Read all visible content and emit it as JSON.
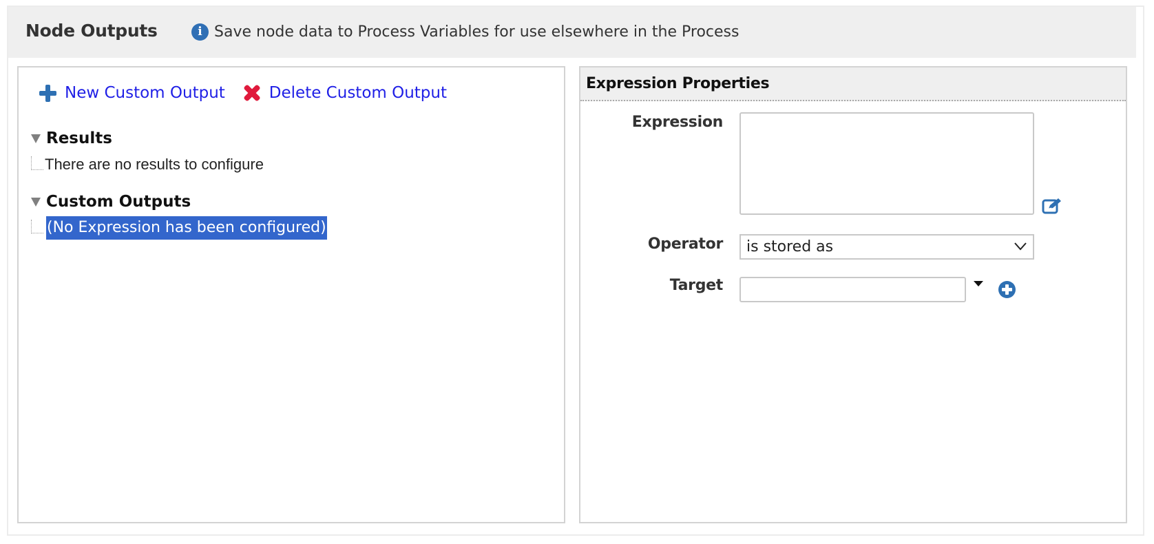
{
  "header": {
    "title": "Node Outputs",
    "help_icon": "info-icon",
    "help_text": "Save node data to Process Variables for use elsewhere in the Process"
  },
  "toolbar": {
    "new_label": "New Custom Output",
    "new_icon": "plus-icon",
    "delete_label": "Delete Custom Output",
    "delete_icon": "x-icon"
  },
  "tree": {
    "groups": [
      {
        "label": "Results",
        "expanded": true,
        "children": [
          {
            "label": "There are no results to configure",
            "selected": false
          }
        ]
      },
      {
        "label": "Custom Outputs",
        "expanded": true,
        "children": [
          {
            "label": "(No Expression has been configured)",
            "selected": true
          }
        ]
      }
    ]
  },
  "properties": {
    "title": "Expression Properties",
    "expression": {
      "label": "Expression",
      "value": "",
      "edit_icon": "edit-icon"
    },
    "operator": {
      "label": "Operator",
      "selected": "is stored as"
    },
    "target": {
      "label": "Target",
      "value": "",
      "dropdown_icon": "caret-down-icon",
      "add_icon": "add-circle-icon"
    }
  },
  "colors": {
    "link": "#1f1fe6",
    "accent_blue": "#2e70b3",
    "delete_red": "#e01a3c",
    "selection": "#3366cc",
    "header_bg": "#efefef",
    "border": "#d3d3d3"
  }
}
